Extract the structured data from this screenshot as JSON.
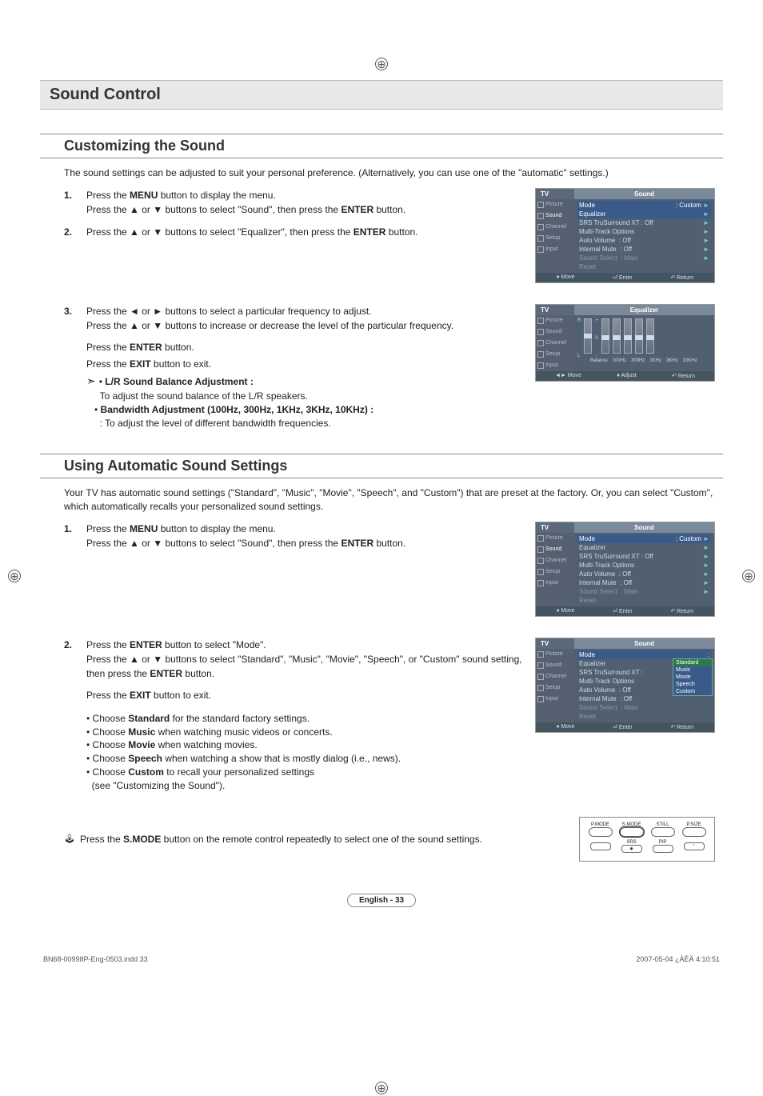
{
  "section_title": "Sound Control",
  "sub1": {
    "title": "Customizing the Sound",
    "intro": "The sound settings can be adjusted to suit your personal preference. (Alternatively, you can use one of the \"automatic\" settings.)",
    "step1_a": "Press the ",
    "step1_b": "MENU",
    "step1_c": " button to display the menu.",
    "step1_d": "Press the ▲ or ▼ buttons to select \"Sound\", then press the ",
    "step1_e": "ENTER",
    "step1_f": " button.",
    "step2_a": "Press the ▲ or ▼ buttons to select \"Equalizer\", then press the ",
    "step2_b": "ENTER",
    "step2_c": " button.",
    "step3_a": "Press the ◄ or ► buttons to select a particular frequency to adjust.",
    "step3_b": "Press the ▲ or ▼ buttons to increase or decrease the level of the particular frequency.",
    "step3_c1": "Press the ",
    "step3_c2": "ENTER",
    "step3_c3": " button.",
    "step3_d1": "Press the ",
    "step3_d2": "EXIT",
    "step3_d3": " button to exit.",
    "note_lr_title": "L/R Sound Balance Adjustment :",
    "note_lr_body": "To adjust the sound balance of the L/R speakers.",
    "note_bw_title": "Bandwidth Adjustment (100Hz, 300Hz, 1KHz, 3KHz, 10KHz) :",
    "note_bw_body": ": To adjust the level of different bandwidth frequencies."
  },
  "sub2": {
    "title": "Using Automatic Sound Settings",
    "intro": "Your TV has automatic sound settings (\"Standard\", \"Music\", \"Movie\", \"Speech\", and \"Custom\") that are preset at the factory. Or, you can select \"Custom\", which automatically recalls your personalized sound settings.",
    "step1_a": "Press the ",
    "step1_b": "MENU",
    "step1_c": " button to display the menu.",
    "step1_d": "Press the ▲ or ▼ buttons to select \"Sound\", then press the ",
    "step1_e": "ENTER",
    "step1_f": " button.",
    "step2_a": "Press the ",
    "step2_b": "ENTER",
    "step2_c": " button to select \"Mode\".",
    "step2_d": "Press the ▲ or ▼ buttons to select \"Standard\", \"Music\", \"Movie\", \"Speech\", or \"Custom\" sound setting, then press the ",
    "step2_e": "ENTER",
    "step2_f": " button.",
    "step2_g1": "Press the ",
    "step2_g2": "EXIT",
    "step2_g3": " button to exit.",
    "bullet1a": "Choose ",
    "bullet1b": "Standard",
    "bullet1c": " for the standard factory settings.",
    "bullet2a": "Choose ",
    "bullet2b": "Music",
    "bullet2c": " when watching music videos or concerts.",
    "bullet3a": "Choose ",
    "bullet3b": "Movie",
    "bullet3c": " when watching movies.",
    "bullet4a": "Choose ",
    "bullet4b": "Speech",
    "bullet4c": " when watching a show that is mostly dialog (i.e., news).",
    "bullet5a": "Choose ",
    "bullet5b": "Custom",
    "bullet5c": " to recall your personalized settings",
    "bullet5d": "(see \"Customizing the Sound\").",
    "tip_a": "Press the ",
    "tip_b": "S.MODE",
    "tip_c": " button on the remote control repeatedly to select one of the sound settings."
  },
  "tv": {
    "tv_label": "TV",
    "sound_title": "Sound",
    "eq_title": "Equalizer",
    "side_picture": "Picture",
    "side_sound": "Sound",
    "side_channel": "Channel",
    "side_setup": "Setup",
    "side_input": "Input",
    "row_mode": "Mode",
    "row_mode_val": ": Custom",
    "row_eq": "Equalizer",
    "row_srs": "SRS TruSurround XT : Off",
    "row_mto": "Multi-Track Options",
    "row_av": "Auto Volume",
    "row_av_val": ": Off",
    "row_im": "Internal Mute",
    "row_im_val": ": Off",
    "row_ss": "Sound Select",
    "row_ss_val": ": Main",
    "row_reset": "Reset",
    "foot_move": "Move",
    "foot_enter": "Enter",
    "foot_return": "Return",
    "foot_adjust": "Adjust",
    "eq_balance": "Balance",
    "eq_r": "R",
    "eq_l": "L",
    "eq_0": "0",
    "eq_plus": "+",
    "eq_minus": "-",
    "eq_100": "100Hz",
    "eq_300": "300Hz",
    "eq_1k": "1KHz",
    "eq_3k": "3KHz",
    "eq_10k": "10KHz",
    "dd_standard": "Standard",
    "dd_music": "Music",
    "dd_movie": "Movie",
    "dd_speech": "Speech",
    "dd_custom": "Custom"
  },
  "remote": {
    "pmode": "P.MODE",
    "smode": "S.MODE",
    "still": "STILL",
    "psize": "P.SIZE",
    "srs": "SRS",
    "pip": "PIP"
  },
  "page_label": "English - 33",
  "doc_footer_left": "BN68-00998P-Eng-0503.indd   33",
  "doc_footer_right": "2007-05-04   ¿ÀÈÄ 4:10:51"
}
